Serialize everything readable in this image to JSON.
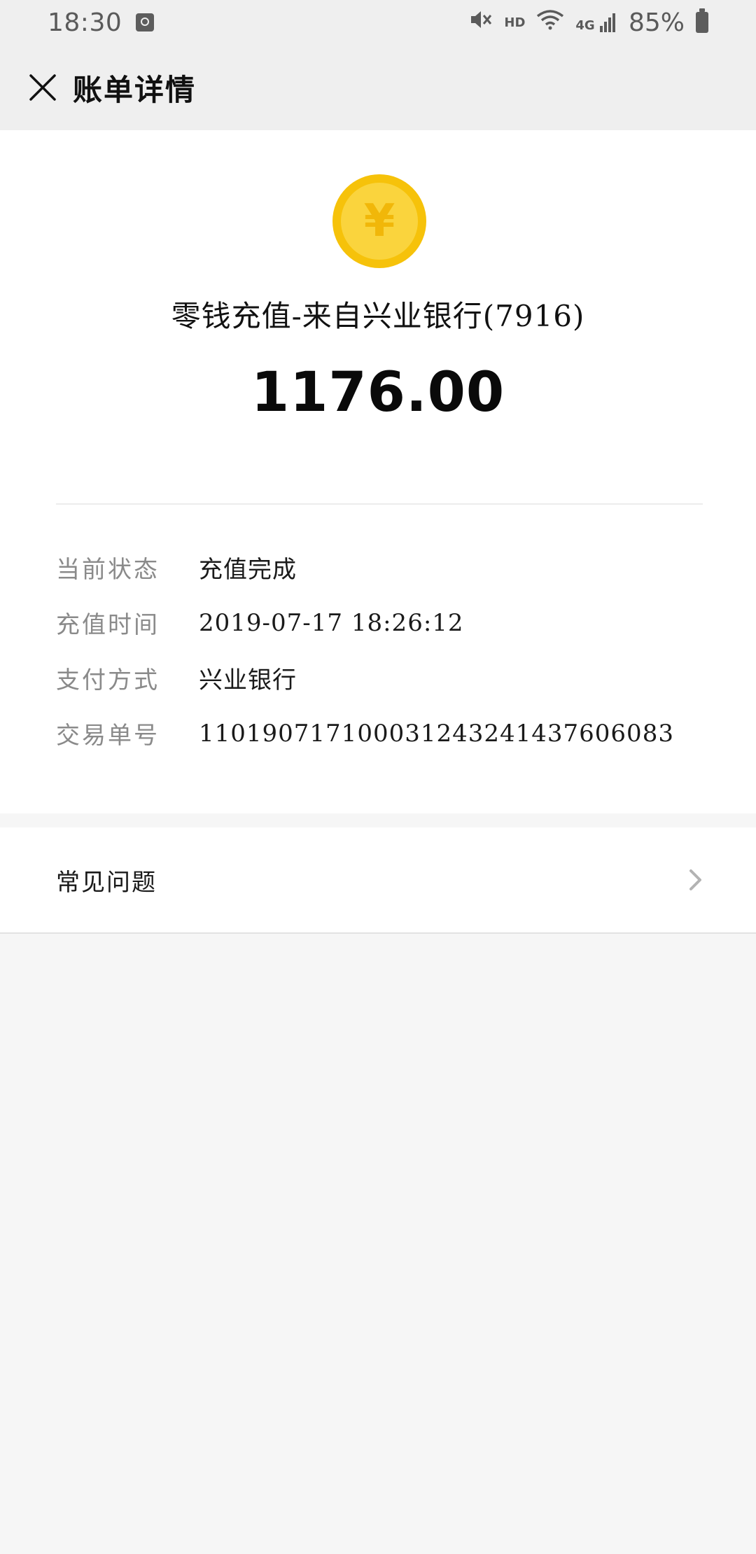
{
  "status_bar": {
    "time": "18:30",
    "hd": "HD",
    "network": "4G",
    "battery": "85%"
  },
  "header": {
    "title": "账单详情"
  },
  "transaction": {
    "title": "零钱充值-来自兴业银行(7916)",
    "amount": "1176.00",
    "coin_symbol": "¥",
    "coin_color": "#f6c20a"
  },
  "details": [
    {
      "label": "当前状态",
      "value": "充值完成"
    },
    {
      "label": "充值时间",
      "value": "2019-07-17 18:26:12"
    },
    {
      "label": "支付方式",
      "value": "兴业银行"
    },
    {
      "label": "交易单号",
      "value": "1101907171000312432414376060​83"
    }
  ],
  "faq": {
    "label": "常见问题"
  }
}
